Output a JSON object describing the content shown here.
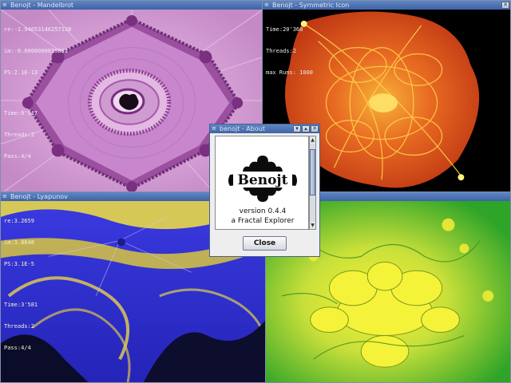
{
  "windows": {
    "mandelbrot": {
      "title": "Benojt - Mandelbrot",
      "info": {
        "re": "re:-1.94053146257138",
        "im": "im:-0.0000000035892",
        "ps": "PS:2.1E-13",
        "time": "Time:0'917",
        "threads": "Threads:2",
        "pass": "Pass:4/4"
      }
    },
    "attractor": {
      "title": "Benojt - Symmetric Icon",
      "info": {
        "time": "Time:20'368",
        "threads": "Threads:2",
        "runs": "max Runs: 1000"
      }
    },
    "lyapunov": {
      "title": "Benojt - Lyapunov",
      "info": {
        "re": "re:3.2659",
        "im": "im:3.8648",
        "ps": "PS:3.1E-5",
        "time": "Time:3'581",
        "threads": "Threads:2",
        "pass": "Pass:4/4"
      }
    },
    "newton": {
      "title": ""
    }
  },
  "about": {
    "title": "benojt - About",
    "logo_text": "Benojt",
    "version": "version 0.4.4",
    "tagline": "a Fractal Explorer",
    "close_label": "Close"
  },
  "titlebar_buttons": {
    "minimize": "▾",
    "maximize": "▴",
    "close": "✕"
  },
  "colors": {
    "mandelbrot_bg": "#c992c9",
    "attractor_bg": "#000000",
    "attractor_fill": "#e6521e",
    "lyapunov_bg": "#2f2fd6",
    "lyapunov_yellow": "#e8dc4a",
    "newton_green": "#3ea82a",
    "newton_yellow": "#f2f030"
  }
}
